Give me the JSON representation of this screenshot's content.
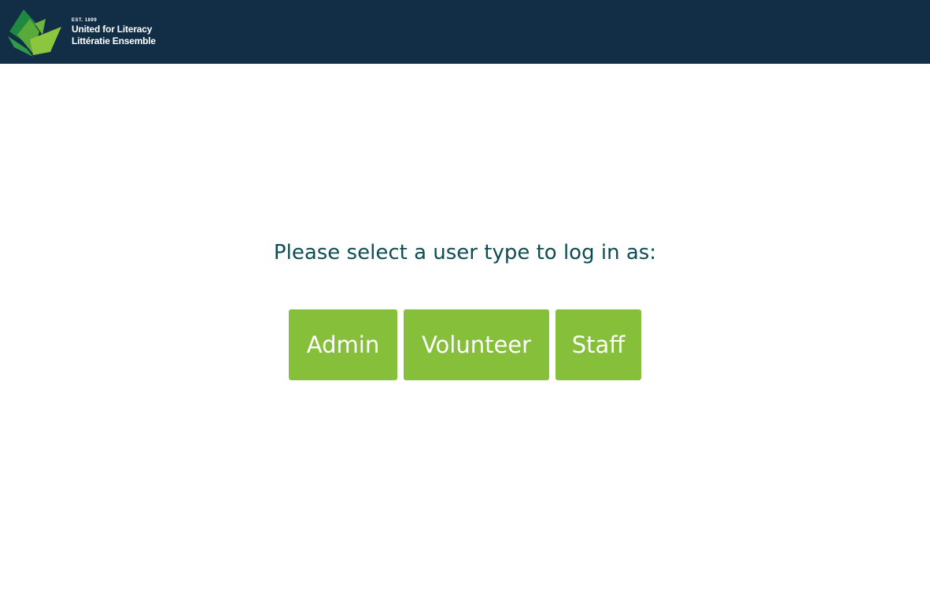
{
  "header": {
    "logo": {
      "est": "EST. 1899",
      "name_en": "United for Literacy",
      "name_fr": "Littératie Ensemble",
      "mark_icon": "open-book-leaves-logo",
      "colors": {
        "dark_green": "#1f8a3f",
        "mid_green": "#5aa93b",
        "light_green": "#8cc63e"
      }
    },
    "background": "#122e47"
  },
  "login": {
    "prompt": "Please select a user type to log in as:",
    "buttons": [
      {
        "label": "Admin"
      },
      {
        "label": "Volunteer"
      },
      {
        "label": "Staff"
      }
    ],
    "button_color": "#86bf39",
    "prompt_color": "#0e4d52"
  }
}
